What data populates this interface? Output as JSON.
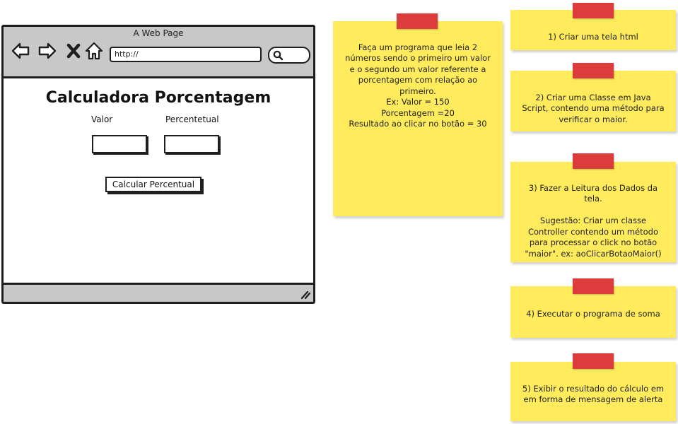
{
  "mockup": {
    "window_title": "A Web Page",
    "url": "http://",
    "heading": "Calculadora Porcentagem",
    "label_valor": "Valor",
    "label_percentual": "Percentetual",
    "button_label": "Calcular Percentual",
    "icons": [
      "back-arrow-icon",
      "forward-arrow-icon",
      "close-icon",
      "home-icon",
      "search-icon",
      "resize-grip-icon"
    ]
  },
  "notes": [
    {
      "id": "main",
      "text": "Faça um programa que leia 2\nnúmeros sendo o primeiro um valor\ne o segundo um valor referente a\nporcentagem com relação ao\nprimeiro.\nEx: Valor = 150\nPorcentagem =20\nResultado ao clicar no botão =  30"
    },
    {
      "id": "step1",
      "text": "1) Criar uma tela html"
    },
    {
      "id": "step2",
      "text": "2) Criar uma Classe em Java\nScript, contendo uma método para\nverificar o maior."
    },
    {
      "id": "step3",
      "text": "3) Fazer a Leitura dos Dados da\ntela.\n\nSugestão: Criar um classe\nController contendo um método\npara processar o click no botão\n\"maior\". ex: aoClicarBotaoMaior()"
    },
    {
      "id": "step4",
      "text": "4) Executar o programa de soma"
    },
    {
      "id": "step5",
      "text": "5) Exibir o resultado do cálculo em\nem forma de mensagem de alerta"
    }
  ],
  "colors": {
    "note": "#ffeb5c",
    "tape": "#dd3c3c",
    "chrome": "#c8c8c8",
    "outline": "#1e1e1e"
  }
}
